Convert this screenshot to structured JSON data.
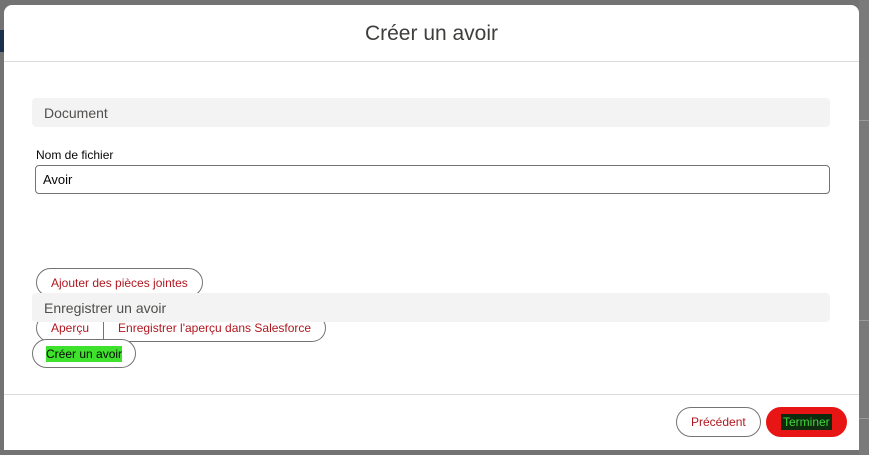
{
  "modal": {
    "title": "Créer un avoir"
  },
  "document_section": {
    "header": "Document",
    "file_name_label": "Nom de fichier",
    "file_name_value": "Avoir",
    "attach_button": "Ajouter des pièces jointes",
    "preview_button": "Aperçu",
    "save_preview_button": "Enregistrer l'aperçu dans Salesforce"
  },
  "save_section": {
    "header": "Enregistrer un avoir",
    "create_button": "Créer un avoir"
  },
  "footer": {
    "previous_button": "Précédent",
    "finish_button": "Terminer"
  },
  "colors": {
    "brand_red": "#b0171f",
    "finish_button": "#e81515",
    "highlight_green": "#3ee12b"
  }
}
